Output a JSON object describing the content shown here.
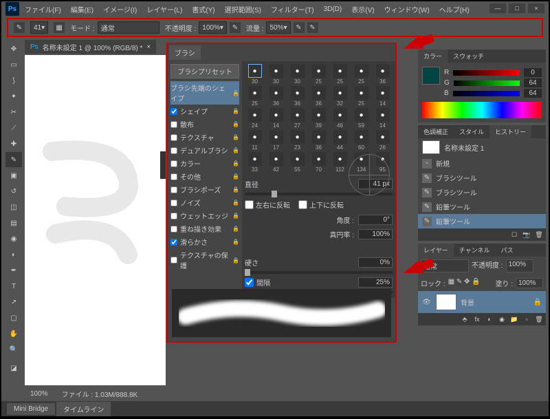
{
  "menu": {
    "items": [
      "ファイル(F)",
      "編集(E)",
      "イメージ(I)",
      "レイヤー(L)",
      "書式(Y)",
      "選択範囲(S)",
      "フィルター(T)",
      "3D(D)",
      "表示(V)",
      "ウィンドウ(W)",
      "ヘルプ(H)"
    ]
  },
  "optbar": {
    "brush_size": "41",
    "mode_lbl": "モード :",
    "mode_val": "通常",
    "opacity_lbl": "不透明度 :",
    "opacity_val": "100%",
    "flow_lbl": "流量 :",
    "flow_val": "50%"
  },
  "doc": {
    "tab": "名称未設定 1 @ 100% (RGB/8) *",
    "zoom": "100%",
    "filesize": "ファイル : 1.03M/888.8K"
  },
  "bottom": {
    "tabs": [
      "Mini Bridge",
      "タイムライン"
    ]
  },
  "brush_panel": {
    "title": "ブラシ",
    "preset_btn": "ブラシプリセット",
    "opts": [
      "ブラシ先端のシェイプ",
      "シェイプ",
      "散布",
      "テクスチャ",
      "デュアルブラシ",
      "カラー",
      "その他",
      "ブラシポーズ",
      "ノイズ",
      "ウェットエッジ",
      "重ね描き効果",
      "滑らかさ",
      "テクスチャの保護"
    ],
    "checked": [
      false,
      true,
      false,
      false,
      false,
      false,
      false,
      false,
      false,
      false,
      false,
      true,
      false
    ],
    "brushes": [
      {
        "s": "30"
      },
      {
        "s": "30"
      },
      {
        "s": "30"
      },
      {
        "s": "25"
      },
      {
        "s": "25"
      },
      {
        "s": "25"
      },
      {
        "s": "36"
      },
      {
        "s": "25"
      },
      {
        "s": "36"
      },
      {
        "s": "36"
      },
      {
        "s": "36"
      },
      {
        "s": "32"
      },
      {
        "s": "25"
      },
      {
        "s": "14"
      },
      {
        "s": "24"
      },
      {
        "s": "14"
      },
      {
        "s": "27"
      },
      {
        "s": "39"
      },
      {
        "s": "46"
      },
      {
        "s": "59"
      },
      {
        "s": "14"
      },
      {
        "s": "11"
      },
      {
        "s": "17"
      },
      {
        "s": "23"
      },
      {
        "s": "36"
      },
      {
        "s": "44"
      },
      {
        "s": "60"
      },
      {
        "s": "26"
      },
      {
        "s": "33"
      },
      {
        "s": "42"
      },
      {
        "s": "55"
      },
      {
        "s": "70"
      },
      {
        "s": "112"
      },
      {
        "s": "134"
      },
      {
        "s": "95"
      }
    ],
    "diameter_lbl": "直径",
    "diameter_val": "41 px",
    "flipx": "左右に反転",
    "flipy": "上下に反転",
    "angle_lbl": "角度 :",
    "angle_val": "0°",
    "round_lbl": "真円率 :",
    "round_val": "100%",
    "hardness_lbl": "硬さ",
    "hardness_val": "0%",
    "spacing_lbl": "間隔",
    "spacing_val": "25%"
  },
  "color": {
    "tabs": [
      "カラー",
      "スウォッチ"
    ],
    "r": "0",
    "g": "64",
    "b": "64",
    "r_lbl": "R",
    "g_lbl": "G",
    "b_lbl": "B"
  },
  "history": {
    "tabs": [
      "色調補正",
      "スタイル",
      "ヒストリー"
    ],
    "doc": "名称未設定 1",
    "items": [
      "新規",
      "ブラシツール",
      "ブラシツール",
      "鉛筆ツール",
      "鉛筆ツール"
    ]
  },
  "layers": {
    "tabs": [
      "レイヤー",
      "チャンネル",
      "パス"
    ],
    "mode": "通常",
    "opacity_lbl": "不透明度 :",
    "opacity_val": "100%",
    "lock_lbl": "ロック :",
    "fill_lbl": "塗り :",
    "fill_val": "100%",
    "layer_name": "背景"
  }
}
